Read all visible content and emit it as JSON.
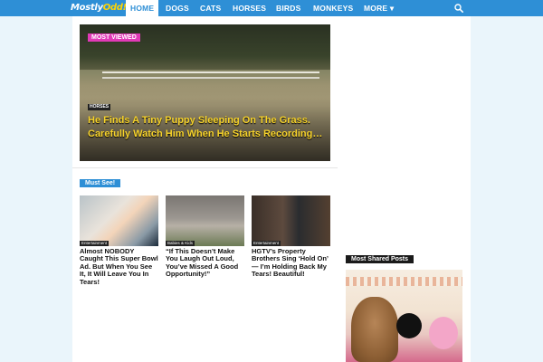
{
  "site": {
    "logo_text": "Mostly",
    "logo_accent": "Odd!"
  },
  "nav": {
    "items": [
      {
        "label": "HOME",
        "active": true
      },
      {
        "label": "DOGS",
        "active": false
      },
      {
        "label": "CATS",
        "active": false
      },
      {
        "label": "HORSES",
        "active": false
      },
      {
        "label": "BIRDS",
        "active": false
      },
      {
        "label": "MONKEYS",
        "active": false
      },
      {
        "label": "MORE",
        "active": false
      }
    ],
    "more_chevron": "▾",
    "search_icon": "search-icon"
  },
  "hero": {
    "badge": "MOST VIEWED",
    "tag": "HORSES",
    "title": "He Finds A Tiny Puppy Sleeping On The Grass. Carefully Watch Him When He Starts Recording…"
  },
  "must_see": {
    "label": "Must See!",
    "cards": [
      {
        "tag": "Entertainment",
        "title": "Almost NOBODY Caught This Super Bowl Ad. But When You See It, It Will Leave You In Tears!"
      },
      {
        "tag": "Babies & Kids",
        "title": "“If This Doesn’t Make You Laugh Out Loud, You’ve Missed A Good Opportunity!”"
      },
      {
        "tag": "Entertainment",
        "title": "HGTV’s Property Brothers Sing ‘Hold On’ — I’m Holding Back My Tears! Beautiful!"
      }
    ]
  },
  "sidebar": {
    "most_shared_label": "Most Shared Posts"
  },
  "colors": {
    "brand": "#2e8fd6",
    "badge_pink": "#e13ab7",
    "hero_title": "#f7d32b"
  }
}
